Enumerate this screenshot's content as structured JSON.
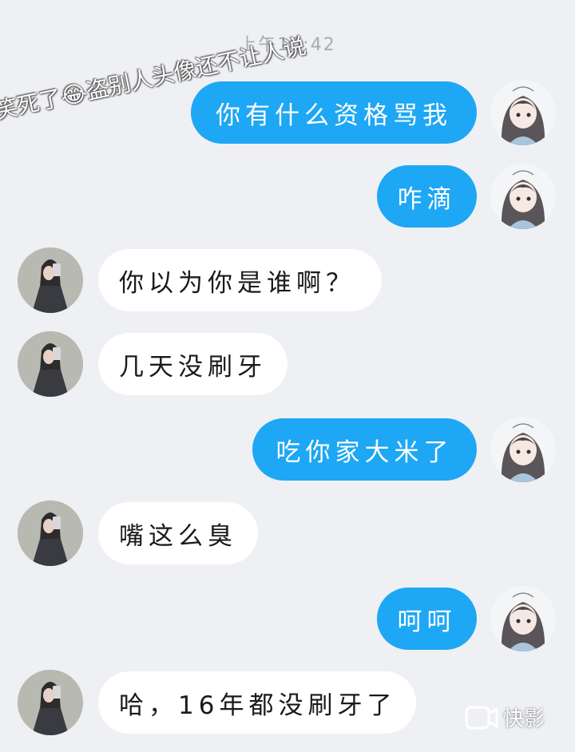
{
  "header": {
    "time": "上午10:42"
  },
  "overlay_caption": "笑死了😂盗别人头像还不让人说",
  "messages": [
    {
      "side": "out",
      "text": "你有什么资格骂我"
    },
    {
      "side": "out",
      "text": "咋滴"
    },
    {
      "side": "in",
      "text": "你以为你是谁啊？"
    },
    {
      "side": "in",
      "text": "几天没刷牙"
    },
    {
      "side": "out",
      "text": "吃你家大米了"
    },
    {
      "side": "in",
      "text": "嘴这么臭"
    },
    {
      "side": "out",
      "text": "呵呵"
    },
    {
      "side": "in",
      "text": "哈，16年都没刷牙了"
    }
  ],
  "watermark": {
    "label": "快影"
  },
  "colors": {
    "out_bubble": "#1ea7f4",
    "in_bubble": "#ffffff",
    "background": "#eef0f4"
  }
}
